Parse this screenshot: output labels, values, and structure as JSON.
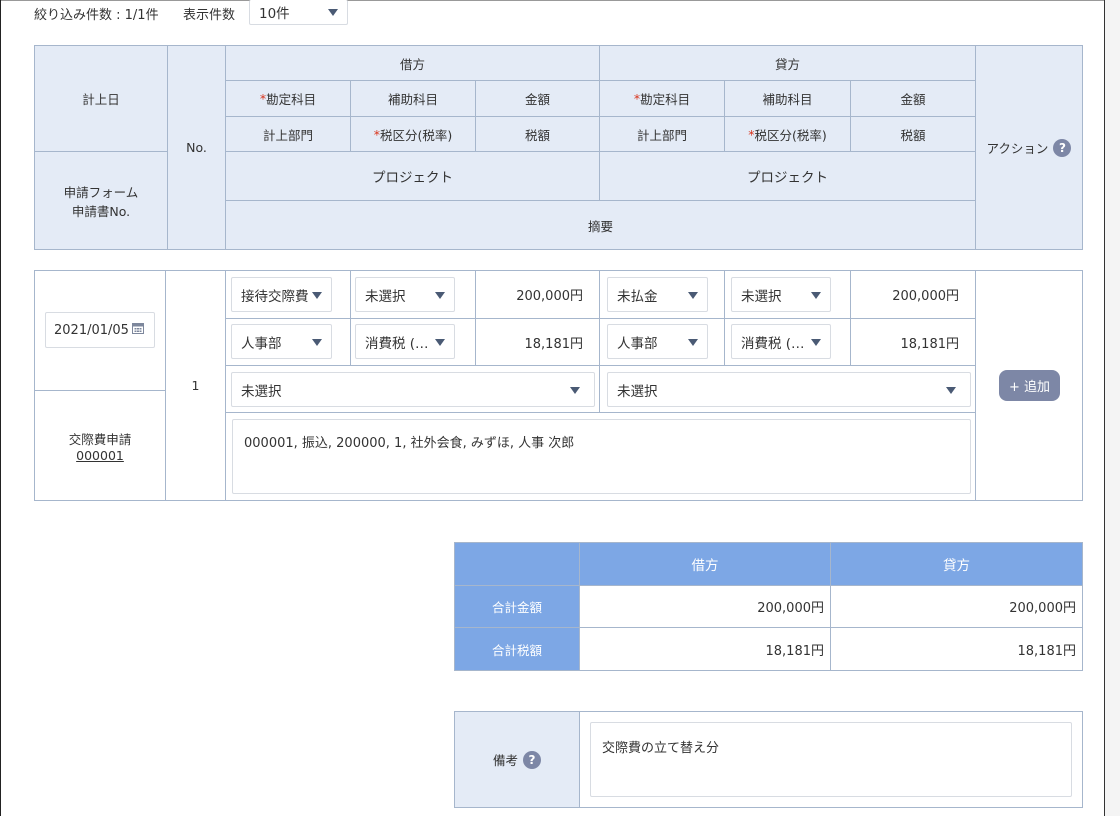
{
  "topbar": {
    "filter_count": "絞り込み件数 : 1/1件",
    "display_count_label": "表示件数",
    "display_count_value": "10件"
  },
  "header": {
    "record_date": "計上日",
    "no": "No.",
    "debit": "借方",
    "credit": "貸方",
    "account": "勘定科目",
    "sub_account": "補助科目",
    "amount": "金額",
    "department": "計上部門",
    "tax_class": "税区分(税率)",
    "tax_amount": "税額",
    "project": "プロジェクト",
    "summary": "摘要",
    "action": "アクション",
    "form_line1": "申請フォーム",
    "form_line2": "申請書No.",
    "help_icon": "question-icon"
  },
  "row": {
    "date": "2021/01/05",
    "no": "1",
    "debit_account": "接待交際費",
    "debit_sub_account": "未選択",
    "debit_amount": "200,000円",
    "credit_account": "未払金",
    "credit_sub_account": "未選択",
    "credit_amount": "200,000円",
    "debit_department": "人事部",
    "debit_tax_class": "消費税 (…",
    "debit_tax_amount": "18,181円",
    "credit_department": "人事部",
    "credit_tax_class": "消費税 (…",
    "credit_tax_amount": "18,181円",
    "debit_project": "未選択",
    "credit_project": "未選択",
    "summary": "000001, 振込, 200000, 1, 社外会食, みずほ, 人事 次郎",
    "form_name": "交際費申請",
    "form_no": "000001",
    "add_label": "+ 追加"
  },
  "totals": {
    "debit": "借方",
    "credit": "貸方",
    "total_amount_label": "合計金額",
    "total_tax_label": "合計税額",
    "debit_total": "200,000円",
    "credit_total": "200,000円",
    "debit_tax": "18,181円",
    "credit_tax": "18,181円"
  },
  "remarks": {
    "label": "備考",
    "value": "交際費の立て替え分"
  },
  "colors": {
    "header_bg": "#e4ebf6",
    "border": "#a6b6cc",
    "total_header": "#7da7e5",
    "button": "#7d87a6",
    "required": "#d9341c"
  }
}
